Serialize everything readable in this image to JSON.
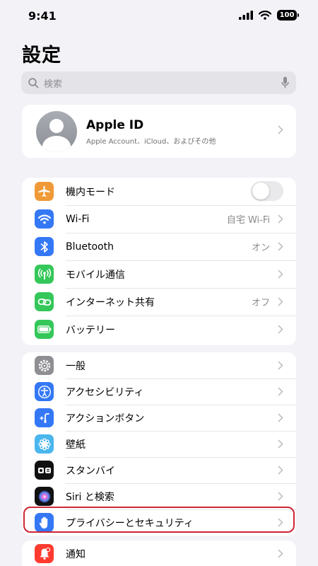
{
  "status_bar": {
    "time": "9:41",
    "battery": "100"
  },
  "page_title": "設定",
  "search": {
    "placeholder": "検索"
  },
  "apple_id": {
    "name": "Apple ID",
    "subtitle": "Apple Account、iCloud、およびその他"
  },
  "group1": [
    {
      "label": "機内モード",
      "icon": "airplane-icon",
      "color": "#f09a37",
      "toggle": false
    },
    {
      "label": "Wi-Fi",
      "icon": "wifi-icon",
      "color": "#3478f6",
      "value": "自宅 Wi-Fi"
    },
    {
      "label": "Bluetooth",
      "icon": "bluetooth-icon",
      "color": "#3478f6",
      "value": "オン"
    },
    {
      "label": "モバイル通信",
      "icon": "antenna-icon",
      "color": "#34c759"
    },
    {
      "label": "インターネット共有",
      "icon": "link-icon",
      "color": "#34c759",
      "value": "オフ"
    },
    {
      "label": "バッテリー",
      "icon": "battery-icon",
      "color": "#34c759"
    }
  ],
  "group2": [
    {
      "label": "一般",
      "icon": "gear-icon",
      "color": "#8e8e93"
    },
    {
      "label": "アクセシビリティ",
      "icon": "accessibility-icon",
      "color": "#3478f6"
    },
    {
      "label": "アクションボタン",
      "icon": "action-button-icon",
      "color": "#3478f6"
    },
    {
      "label": "壁紙",
      "icon": "flower-icon",
      "color": "#5ac8fa"
    },
    {
      "label": "スタンバイ",
      "icon": "standby-icon",
      "color": "#1c1c1e"
    },
    {
      "label": "Siri と検索",
      "icon": "siri-icon",
      "color": "#1c1c1e"
    },
    {
      "label": "プライバシーとセキュリティ",
      "icon": "hand-icon",
      "color": "#3478f6"
    }
  ],
  "group3": [
    {
      "label": "通知",
      "icon": "bell-icon",
      "color": "#ff3b30"
    }
  ],
  "highlight_color": "#cf2536"
}
